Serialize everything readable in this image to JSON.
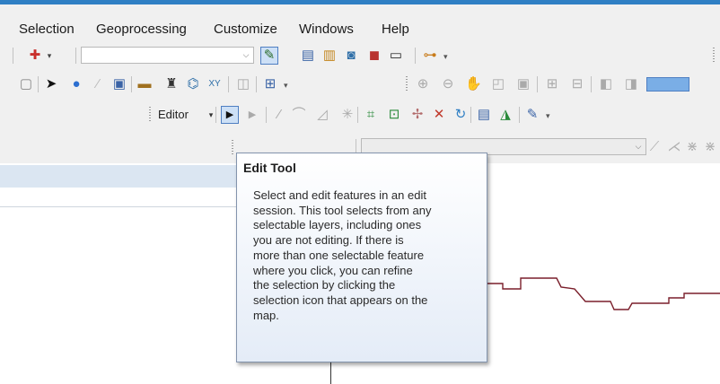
{
  "menubar": {
    "items": [
      "Selection",
      "Geoprocessing",
      "Customize",
      "Windows",
      "Help"
    ]
  },
  "toolbar_row1": {
    "combo_value": "",
    "icons": [
      "add-data-icon",
      "editor-toolbar-icon",
      "table-icon",
      "catalog-icon",
      "search-icon",
      "toolbox-icon",
      "python-icon",
      "modelbuilder-icon"
    ]
  },
  "toolbar_row2": {
    "icons": [
      "clear-selection-icon",
      "select-elements-icon",
      "identify-icon",
      "hyperlink-icon",
      "html-popup-icon",
      "measure-icon",
      "find-icon",
      "find-route-icon",
      "goto-xy-icon",
      "time-slider-icon",
      "viewer-icon"
    ]
  },
  "editor_toolbar": {
    "editor_label": "Editor",
    "icons": [
      "edit-tool-icon",
      "edit-annotation-icon",
      "straight-segment-icon",
      "end-point-arc-icon",
      "trace-icon",
      "point-icon",
      "edit-vertices-icon",
      "reshape-icon",
      "cut-polygons-icon",
      "split-icon",
      "rotate-icon",
      "attributes-icon",
      "sketch-properties-icon",
      "create-features-icon"
    ]
  },
  "tooltip": {
    "title": "Edit Tool",
    "body": "Select and edit features in an edit\nsession. This tool selects from any\nselectable layers, including ones\nyou are not editing. If there is\nmore than one selectable feature\nwhere you click, you can refine\nthe selection by clicking the\nselection icon that appears on the\nmap."
  },
  "colors": {
    "accent": "#2f7fc4",
    "map_line": "#7a1f2b",
    "tooltip_border": "#8394ad"
  }
}
